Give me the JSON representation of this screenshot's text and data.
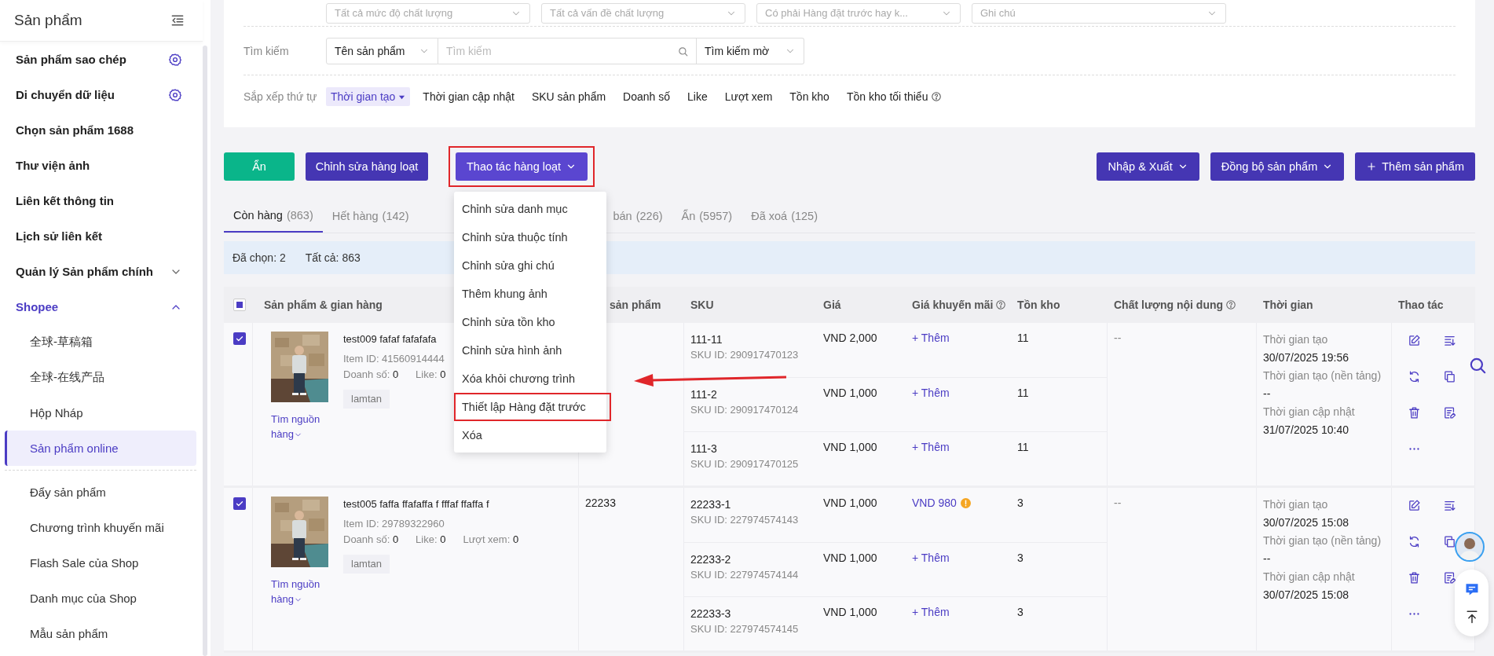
{
  "sidebar": {
    "title": "Sản phẩm",
    "items": [
      {
        "label": "Sản phẩm sao chép",
        "kind": "gear",
        "selected": false
      },
      {
        "label": "Di chuyển dữ liệu",
        "kind": "gear",
        "selected": false
      },
      {
        "label": "Chọn sản phẩm 1688",
        "kind": "plain",
        "selected": false
      },
      {
        "label": "Thư viện ảnh",
        "kind": "plain",
        "selected": false
      },
      {
        "label": "Liên kết thông tin",
        "kind": "plain",
        "selected": false
      },
      {
        "label": "Lịch sử liên kết",
        "kind": "plain",
        "selected": false
      },
      {
        "label": "Quản lý Sản phẩm chính",
        "kind": "group",
        "expanded": false,
        "selected": false
      },
      {
        "label": "Shopee",
        "kind": "group",
        "expanded": true,
        "selected": true,
        "sections": [
          {
            "children": [
              {
                "label": "全球-草稿箱",
                "selected": false
              },
              {
                "label": "全球-在线产品",
                "selected": false
              },
              {
                "label": "Hộp Nháp",
                "selected": false
              },
              {
                "label": "Sản phẩm online",
                "selected": true
              }
            ]
          },
          {
            "children": [
              {
                "label": "Đẩy sản phẩm",
                "selected": false
              },
              {
                "label": "Chương trình khuyến mãi",
                "selected": false
              },
              {
                "label": "Flash Sale của Shop",
                "selected": false
              },
              {
                "label": "Danh mục của Shop",
                "selected": false
              },
              {
                "label": "Mẫu sản phẩm",
                "selected": false
              }
            ]
          }
        ]
      }
    ]
  },
  "filters": {
    "quality": [
      "Tất cả mức độ chất lượng",
      "Tất cả vấn đề chất lượng",
      "Có phải Hàng đặt trước hay k...",
      "Ghi chú"
    ],
    "search": {
      "label": "Tìm kiếm",
      "field": "Tên sản phẩm",
      "placeholder": "Tìm kiếm",
      "mode": "Tìm kiếm mờ"
    },
    "sort": {
      "label": "Sắp xếp thứ tự",
      "options": [
        {
          "label": "Thời gian tạo",
          "selected": true,
          "help": false
        },
        {
          "label": "Thời gian cập nhật",
          "selected": false,
          "help": false
        },
        {
          "label": "SKU sản phẩm",
          "selected": false,
          "help": false
        },
        {
          "label": "Doanh số",
          "selected": false,
          "help": false
        },
        {
          "label": "Like",
          "selected": false,
          "help": false
        },
        {
          "label": "Lượt xem",
          "selected": false,
          "help": false
        },
        {
          "label": "Tồn kho",
          "selected": false,
          "help": false
        },
        {
          "label": "Tồn kho tối thiểu",
          "selected": false,
          "help": true
        }
      ]
    }
  },
  "toolbar": {
    "left": [
      {
        "label": "Ẩn",
        "kind": "success",
        "highlighted": false
      },
      {
        "label": "Chỉnh sửa hàng loạt",
        "kind": "primary",
        "highlighted": false
      },
      {
        "label": "Thao tác hàng loạt",
        "kind": "menu",
        "highlighted": true,
        "menu": {
          "items": [
            {
              "label": "Chỉnh sửa danh mục",
              "highlighted": false
            },
            {
              "label": "Chỉnh sửa thuộc tính",
              "highlighted": false
            },
            {
              "label": "Chỉnh sửa ghi chú",
              "highlighted": false
            },
            {
              "label": "Thêm khung ảnh",
              "highlighted": false
            },
            {
              "label": "Chỉnh sửa tồn kho",
              "highlighted": false
            },
            {
              "label": "Chỉnh sửa hình ảnh",
              "highlighted": false
            },
            {
              "label": "Xóa khỏi chương trình",
              "highlighted": false
            },
            {
              "label": "Thiết lập Hàng đặt trước",
              "highlighted": true
            },
            {
              "label": "Xóa",
              "highlighted": false
            }
          ]
        }
      }
    ],
    "right": [
      {
        "label": "Nhập & Xuất",
        "kind": "menu",
        "highlighted": false
      },
      {
        "label": "Đồng bộ sản phẩm",
        "kind": "menu",
        "highlighted": false
      },
      {
        "label": "Thêm sản phẩm",
        "kind": "add",
        "highlighted": false
      }
    ]
  },
  "tabs": [
    {
      "label": "Còn hàng",
      "count": "(863)",
      "selected": true
    },
    {
      "label": "Hết hàng",
      "count": "(142)",
      "selected": false
    },
    {
      "label": "bán",
      "count": "(226)",
      "selected": false
    },
    {
      "label": "Ẩn",
      "count": "(5957)",
      "selected": false
    },
    {
      "label": "Đã xoá",
      "count": "(125)",
      "selected": false
    }
  ],
  "selection": {
    "selected": "Đã chọn: 2",
    "total": "Tất cả: 863"
  },
  "table": {
    "select_all": {
      "partial": true
    },
    "columns": [
      {
        "label": "Sản phẩm & gian hàng",
        "help": false
      },
      {
        "label": "sản phẩm",
        "help": false
      },
      {
        "label": "SKU",
        "help": false
      },
      {
        "label": "Giá",
        "help": false
      },
      {
        "label": "Giá khuyến mãi",
        "help": true
      },
      {
        "label": "Tồn kho",
        "help": false
      },
      {
        "label": "Chất lượng nội dung",
        "help": true
      },
      {
        "label": "Thời gian",
        "help": false
      },
      {
        "label": "Thao tác",
        "help": false
      }
    ],
    "rows": [
      {
        "checked": true,
        "title": "test009 fafaf fafafafa",
        "item_id": "Item ID: 41560914444",
        "stats": [
          {
            "label": "Doanh số:",
            "value": "0"
          },
          {
            "label": "Like:",
            "value": "0"
          }
        ],
        "tag": "lamtan",
        "source": "Tìm nguồn hàng",
        "image": {
          "kind": "picture"
        },
        "variants": [
          {
            "sku": "111-11",
            "sku_id": "SKU ID: 290917470123",
            "price": "VND 2,000",
            "promo": {
              "kind": "add",
              "text": "+ Thêm"
            },
            "stock": "11"
          },
          {
            "sku": "111-2",
            "sku_id": "SKU ID: 290917470124",
            "price": "VND 1,000",
            "promo": {
              "kind": "add",
              "text": "+ Thêm"
            },
            "stock": "11"
          },
          {
            "sku": "111-3",
            "sku_id": "SKU ID: 290917470125",
            "price": "VND 1,000",
            "promo": {
              "kind": "add",
              "text": "+ Thêm"
            },
            "stock": "11"
          }
        ],
        "quality": "--",
        "times": [
          {
            "label": "Thời gian tạo",
            "value": "30/07/2025 19:56"
          },
          {
            "label": "Thời gian tạo (nền tảng)",
            "value": "--"
          },
          {
            "label": "Thời gian cập nhật",
            "value": "31/07/2025 10:40"
          }
        ]
      },
      {
        "checked": true,
        "title": "test005 faffa ffafaffa f fffaf ffaffa f",
        "item_id": "Item ID: 29789322960",
        "stats": [
          {
            "label": "Doanh số:",
            "value": "0"
          },
          {
            "label": "Like:",
            "value": "0"
          },
          {
            "label": "Lượt xem:",
            "value": "0"
          }
        ],
        "tag": "lamtan",
        "source": "Tìm nguồn hàng",
        "code": "22233",
        "image": {
          "kind": "picture"
        },
        "variants": [
          {
            "sku": "22233-1",
            "sku_id": "SKU ID: 227974574143",
            "price": "VND 1,000",
            "promo": {
              "kind": "price",
              "text": "VND 980",
              "warning": true
            },
            "stock": "3"
          },
          {
            "sku": "22233-2",
            "sku_id": "SKU ID: 227974574144",
            "price": "VND 1,000",
            "promo": {
              "kind": "add",
              "text": "+ Thêm"
            },
            "stock": "3"
          },
          {
            "sku": "22233-3",
            "sku_id": "SKU ID: 227974574145",
            "price": "VND 1,000",
            "promo": {
              "kind": "add",
              "text": "+ Thêm"
            },
            "stock": "3"
          }
        ],
        "quality": "--",
        "times": [
          {
            "label": "Thời gian tạo",
            "value": "30/07/2025 15:08"
          },
          {
            "label": "Thời gian tạo (nền tảng)",
            "value": "--"
          },
          {
            "label": "Thời gian cập nhật",
            "value": "30/07/2025 15:08"
          }
        ]
      }
    ]
  }
}
